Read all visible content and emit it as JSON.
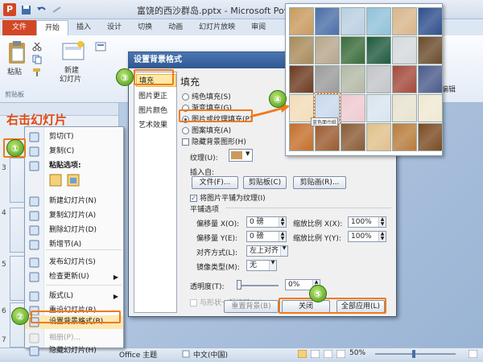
{
  "window": {
    "title": "富饶的西沙群岛.pptx - Microsoft PowerPoint"
  },
  "ribbon": {
    "tabs": [
      "文件",
      "开始",
      "插入",
      "设计",
      "切换",
      "动画",
      "幻灯片放映",
      "审阅"
    ],
    "paste_label": "粘贴",
    "new_slide_label": [
      "新建",
      "幻灯片"
    ],
    "clipboard_group": "剪贴板",
    "edit_label": "编辑"
  },
  "annotation": {
    "text": "右击幻灯片",
    "steps": [
      "①",
      "②",
      "③",
      "④",
      "⑤"
    ]
  },
  "slide_pane": {
    "numbers": [
      "3",
      "4",
      "5",
      "6",
      "7"
    ]
  },
  "context_menu": {
    "items": [
      {
        "label": "剪切(T)",
        "icon": "scissors-icon",
        "enabled": true
      },
      {
        "label": "复制(C)",
        "icon": "copy-icon",
        "enabled": true
      },
      {
        "label": "粘贴选项:",
        "icon": "paste-icon",
        "enabled": true,
        "bold": true
      },
      {
        "label": "新建幻灯片(N)",
        "icon": "new-slide-icon",
        "enabled": true
      },
      {
        "label": "复制幻灯片(A)",
        "icon": "duplicate-slide-icon",
        "enabled": true
      },
      {
        "label": "删除幻灯片(D)",
        "icon": "delete-slide-icon",
        "enabled": true
      },
      {
        "label": "新增节(A)",
        "icon": "new-section-icon",
        "enabled": true
      },
      {
        "label": "发布幻灯片(S)",
        "icon": "publish-icon",
        "enabled": true
      },
      {
        "label": "检查更新(U)",
        "icon": "check-update-icon",
        "enabled": true,
        "submenu": true
      },
      {
        "label": "版式(L)",
        "icon": "layout-icon",
        "enabled": true,
        "submenu": true
      },
      {
        "label": "重设幻灯片(R)",
        "icon": "reset-icon",
        "enabled": true
      },
      {
        "label": "设置背景格式(B)...",
        "icon": "format-background-icon",
        "enabled": true,
        "highlighted": true
      },
      {
        "label": "相册(P)...",
        "icon": "album-icon",
        "enabled": false
      },
      {
        "label": "隐藏幻灯片(H)",
        "icon": "hide-slide-icon",
        "enabled": true
      }
    ]
  },
  "dialog": {
    "title": "设置背景格式",
    "nav": [
      "填充",
      "图片更正",
      "图片颜色",
      "艺术效果"
    ],
    "heading": "填充",
    "fill_options": [
      "纯色填充(S)",
      "渐变填充(G)",
      "图片或纹理填充(P)",
      "图案填充(A)"
    ],
    "selected_fill": 2,
    "hide_bg_graphics": "隐藏背景图形(H)",
    "texture_label": "纹理(U):",
    "insert_from": "插入自:",
    "btn_file": "文件(F)...",
    "btn_clipboard": "剪贴板(C)",
    "btn_clipart": "剪贴画(R)...",
    "tile_checkbox": "将图片平铺为纹理(I)",
    "tile_checked": true,
    "tile_options": "平铺选项",
    "offset_x_label": "偏移量 X(O):",
    "offset_x": "0 磅",
    "scale_x_label": "缩放比例 X(X):",
    "scale_x": "100%",
    "offset_y_label": "偏移量 Y(E):",
    "offset_y": "0 磅",
    "scale_y_label": "缩放比例 Y(Y):",
    "scale_y": "100%",
    "align_label": "对齐方式(L):",
    "align_value": "左上对齐",
    "mirror_label": "镜像类型(M):",
    "mirror_value": "无",
    "transparency_label": "透明度(T):",
    "transparency": "0%",
    "rotate_with_shape": "与形状一起旋转(W)",
    "btn_reset": "重置背景(B)",
    "btn_close": "关闭",
    "btn_apply_all": "全部应用(L)"
  },
  "gallery": {
    "tooltip": "蓝色面巾纸",
    "colors": [
      "#c99a5e",
      "#4a6ea8",
      "#b9cfe0",
      "#8fc2d8",
      "#d8b58a",
      "#2e4e8c",
      "#a88a5a",
      "#b6a58a",
      "#3a6b3a",
      "#1e5a3c",
      "#d5d9dc",
      "#6a4a2a",
      "#6b3a1e",
      "#9a9a9a",
      "#b3b8a5",
      "#c2c4c8",
      "#a34a3a",
      "#4a5a8a",
      "#f2dcb8",
      "#c8d8ec",
      "#efc9d2",
      "#d8e4ee",
      "#e8e2cf",
      "#efe8d2",
      "#c46e2a",
      "#9a5a2e",
      "#8a5a34",
      "#e0c089",
      "#b77c3c",
      "#7a4a22"
    ]
  },
  "status": {
    "theme": "Office 主题",
    "lang": "中文(中国)",
    "zoom": "50%"
  }
}
